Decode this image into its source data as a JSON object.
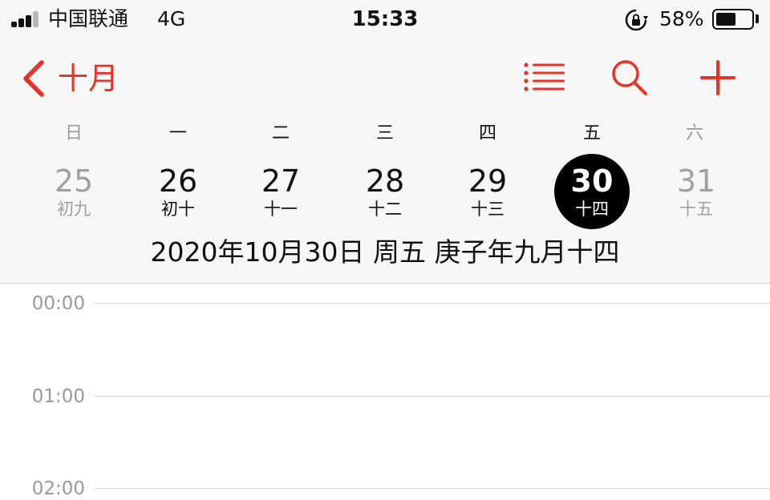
{
  "status_bar": {
    "carrier": "中国联通",
    "network": "4G",
    "time": "15:33",
    "battery_percent_label": "58%",
    "battery_level": 0.58,
    "signal_bars_total": 4,
    "signal_bars_active": 3
  },
  "nav": {
    "back_label": "十月",
    "accent_color": "#e5332a",
    "icons": [
      "chevron-left-icon",
      "list-icon",
      "search-icon",
      "add-icon"
    ]
  },
  "week": {
    "weekdays": [
      "日",
      "一",
      "二",
      "三",
      "四",
      "五",
      "六"
    ],
    "days": [
      {
        "num": "25",
        "lunar": "初九",
        "muted": true
      },
      {
        "num": "26",
        "lunar": "初十",
        "muted": false
      },
      {
        "num": "27",
        "lunar": "十一",
        "muted": false
      },
      {
        "num": "28",
        "lunar": "十二",
        "muted": false
      },
      {
        "num": "29",
        "lunar": "十三",
        "muted": false
      },
      {
        "num": "30",
        "lunar": "十四",
        "selected": true
      },
      {
        "num": "31",
        "lunar": "十五",
        "muted": true
      }
    ]
  },
  "selected_date_title": "2020年10月30日 周五   庚子年九月十四",
  "timeline": {
    "hours": [
      "00:00",
      "01:00",
      "02:00"
    ]
  }
}
